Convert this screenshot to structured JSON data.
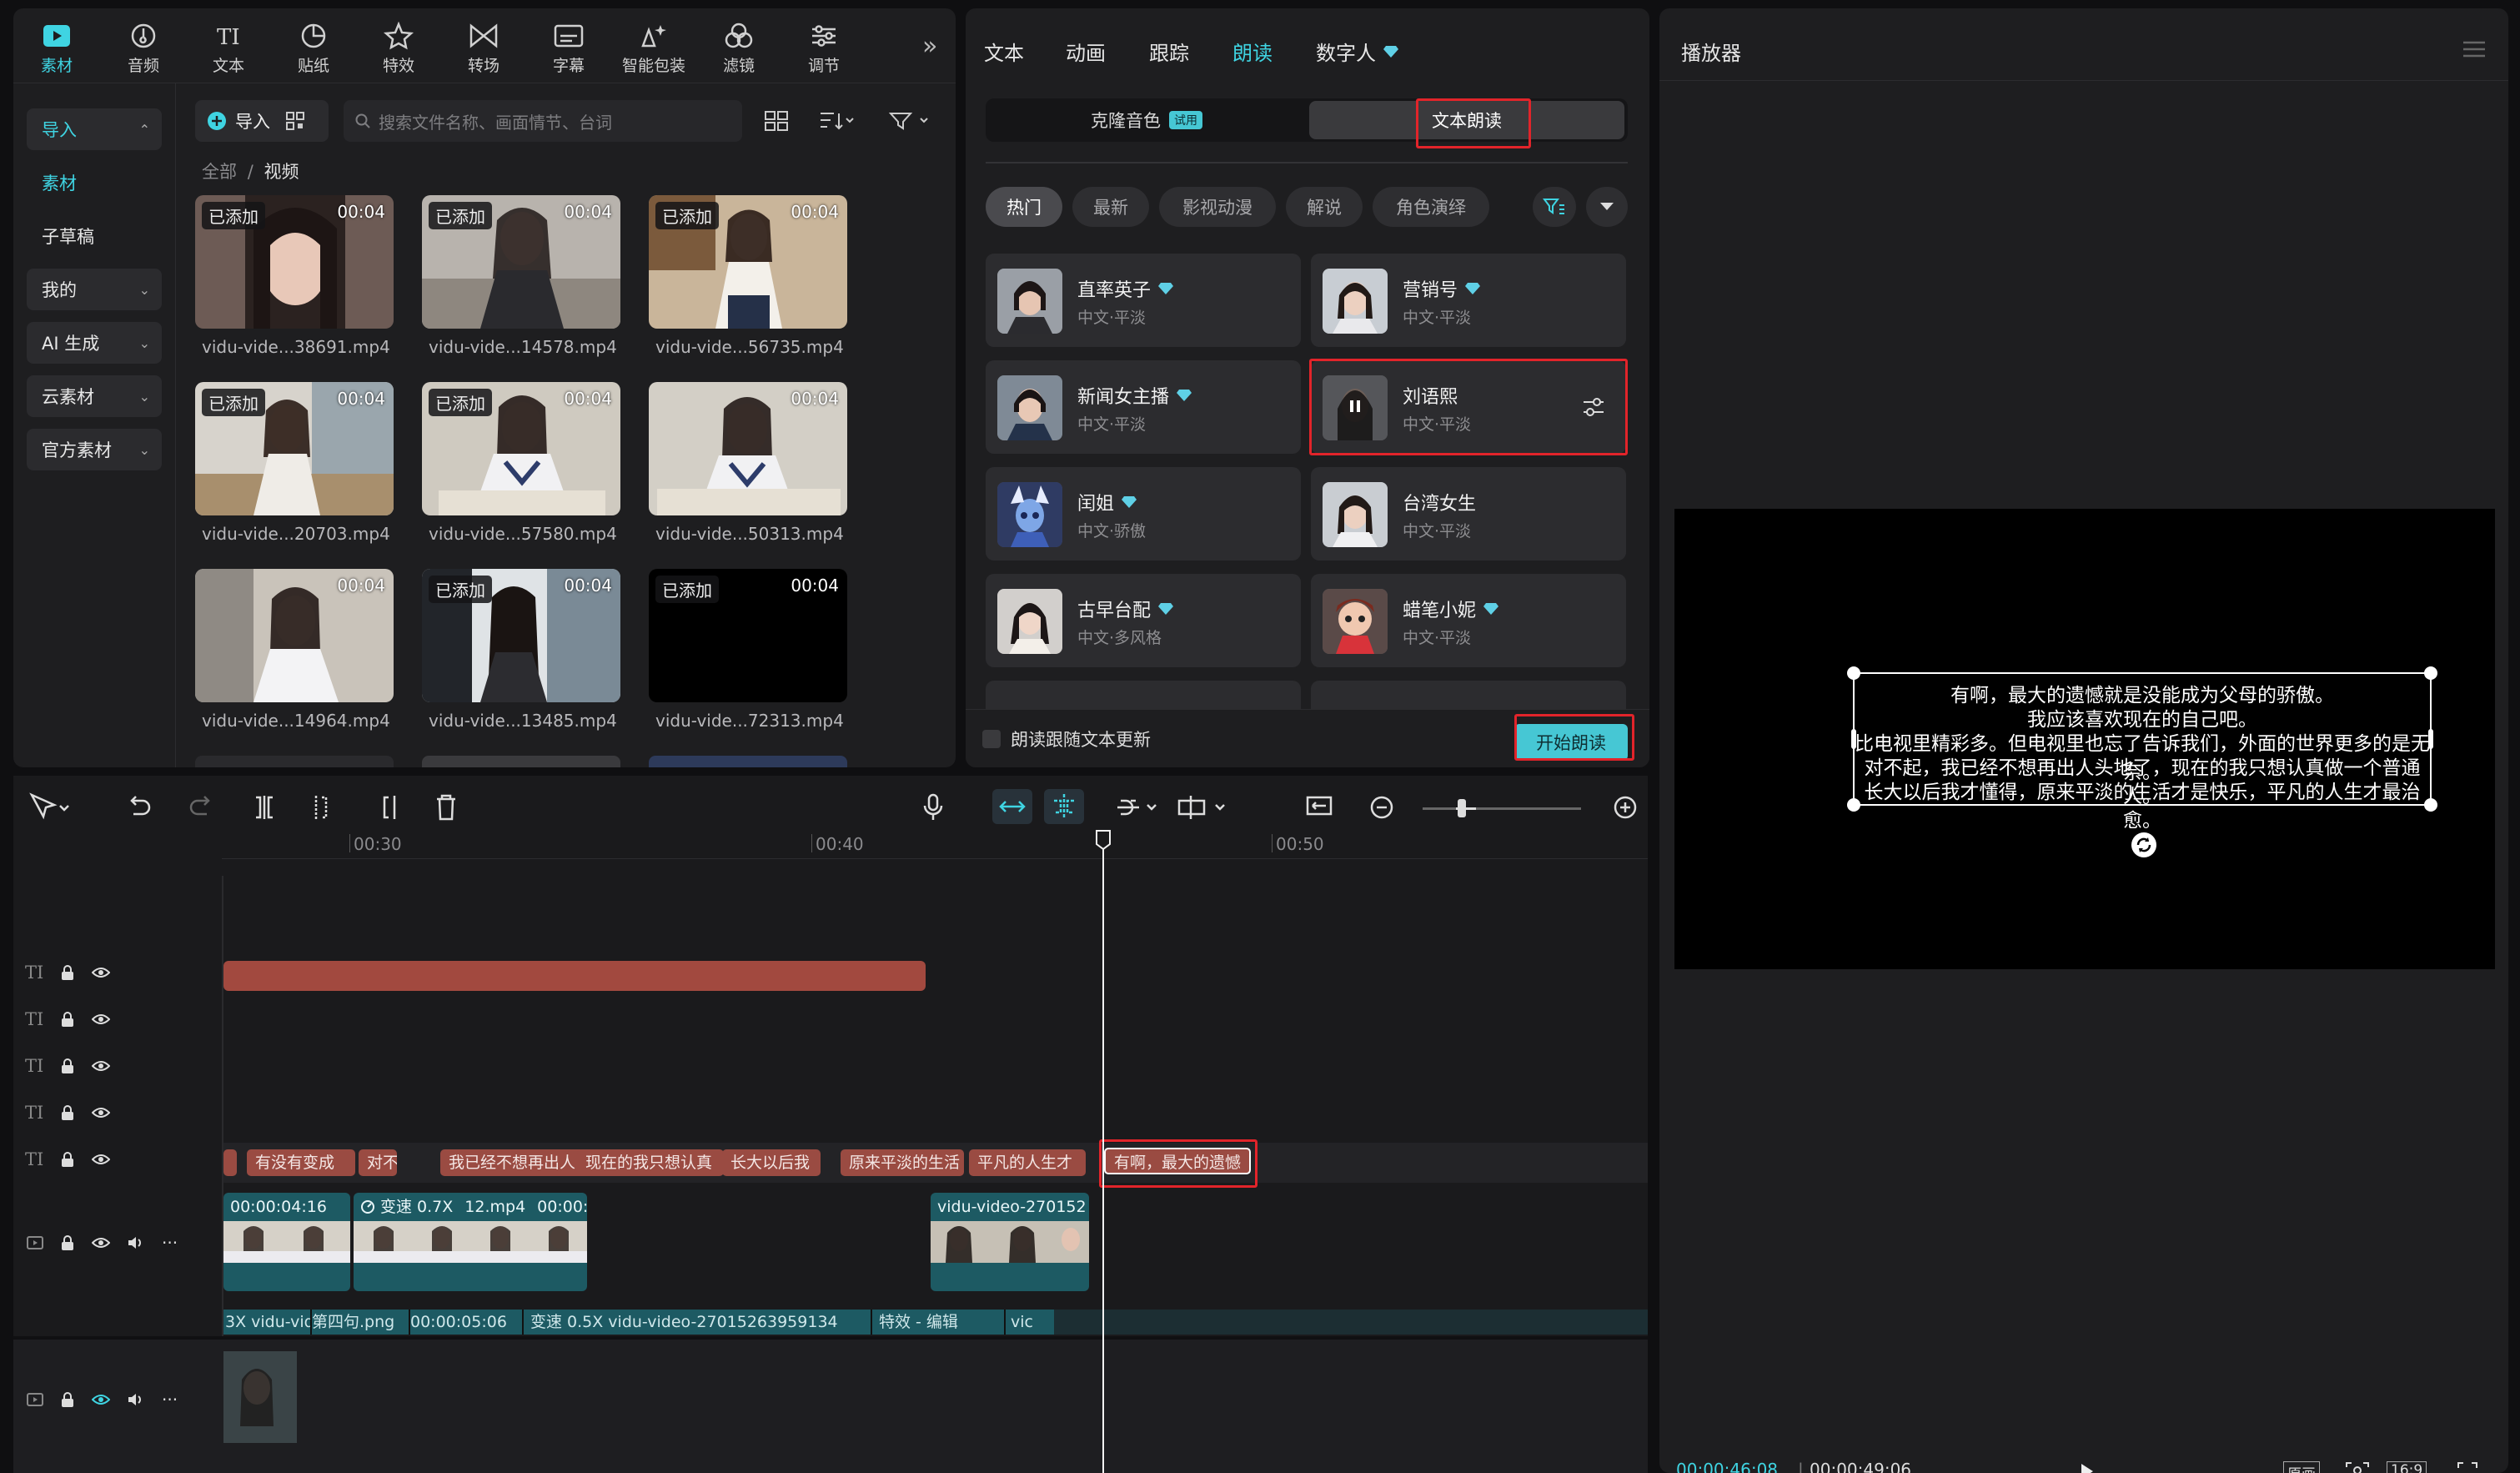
{
  "media": {
    "tools": [
      "素材",
      "音频",
      "文本",
      "贴纸",
      "特效",
      "转场",
      "字幕",
      "智能包装",
      "滤镜",
      "调节"
    ],
    "more_label": "»",
    "sidebar": [
      {
        "label": "导入"
      },
      {
        "label": "素材"
      },
      {
        "label": "子草稿"
      },
      {
        "label": "我的"
      },
      {
        "label": "AI 生成"
      },
      {
        "label": "云素材"
      },
      {
        "label": "官方素材"
      }
    ],
    "import_label": "导入",
    "search_placeholder": "搜索文件名称、画面情节、台词",
    "crumb_all": "全部",
    "crumb_sep": "/",
    "crumb_current": "视频",
    "files": [
      {
        "name": "vidu-vide...38691.mp4",
        "tag": "已添加",
        "dur": "00:04"
      },
      {
        "name": "vidu-vide...14578.mp4",
        "tag": "已添加",
        "dur": "00:04"
      },
      {
        "name": "vidu-vide...56735.mp4",
        "tag": "已添加",
        "dur": "00:04"
      },
      {
        "name": "vidu-vide...20703.mp4",
        "tag": "已添加",
        "dur": "00:04"
      },
      {
        "name": "vidu-vide...57580.mp4",
        "tag": "已添加",
        "dur": "00:04"
      },
      {
        "name": "vidu-vide...50313.mp4",
        "tag": "",
        "dur": "00:04"
      },
      {
        "name": "vidu-vide...14964.mp4",
        "tag": "",
        "dur": "00:04"
      },
      {
        "name": "vidu-vide...13485.mp4",
        "tag": "已添加",
        "dur": "00:04"
      },
      {
        "name": "vidu-vide...72313.mp4",
        "tag": "已添加",
        "dur": "00:04"
      }
    ]
  },
  "voice": {
    "tabs": [
      "文本",
      "动画",
      "跟踪",
      "朗读",
      "数字人"
    ],
    "clone_label": "克隆音色",
    "trial_label": "试用",
    "tts_label": "文本朗读",
    "filters": [
      "热门",
      "最新",
      "影视动漫",
      "解说",
      "角色演绎"
    ],
    "voices": [
      {
        "name": "直率英子",
        "desc": "中文·平淡"
      },
      {
        "name": "营销号",
        "desc": "中文·平淡"
      },
      {
        "name": "新闻女主播",
        "desc": "中文·平淡"
      },
      {
        "name": "刘语熙",
        "desc": "中文·平淡"
      },
      {
        "name": "闰姐",
        "desc": "中文·骄傲"
      },
      {
        "name": "台湾女生",
        "desc": "中文·平淡"
      },
      {
        "name": "古早台配",
        "desc": "中文·多风格"
      },
      {
        "name": "蜡笔小妮",
        "desc": "中文·平淡"
      }
    ],
    "follow_label": "朗读跟随文本更新",
    "start_label": "开始朗读"
  },
  "player": {
    "title": "播放器",
    "subtitles": [
      "有啊，最大的遗憾就是没能成为父母的骄傲。",
      "我应该喜欢现在的自己吧。",
      "比电视里精彩多。但电视里也忘了告诉我们，外面的世界更多的是无奈。",
      "对不起，我已经不想再出人头地了，现在的我只想认真做一个普通人。",
      "长大以后我才懂得，原来平淡的生活才是快乐，平凡的人生才最治愈。"
    ],
    "current_time": "00:00:46:08",
    "total_time": "00:00:49:06",
    "ratio_label": "16:9",
    "original_label": "原画"
  },
  "timeline": {
    "ruler": [
      "00:30",
      "00:40",
      "00:50"
    ],
    "text_clips": [
      {
        "label": "有没有变成"
      },
      {
        "label": "对不"
      },
      {
        "label": "我已经不想再出人"
      },
      {
        "label": "现在的我只想认真"
      },
      {
        "label": "长大以后我"
      },
      {
        "label": "原来平淡的生活"
      },
      {
        "label": "平凡的人生才"
      },
      {
        "label": "有啊，最大的遗憾"
      }
    ],
    "video_clips": [
      {
        "label": "00:00:04:16"
      },
      {
        "label": "变速 0.7X"
      },
      {
        "label": "12.mp4"
      },
      {
        "label": "00:00:"
      },
      {
        "label": "vidu-video-270152"
      }
    ],
    "lower_clips": [
      {
        "label": "3X  vidu-video"
      },
      {
        "label": "第四句.png"
      },
      {
        "label": "00:00:05:06"
      },
      {
        "label": "变速 0.5X  vidu-video-27015263959134"
      },
      {
        "label": "特效 - 编辑"
      },
      {
        "label": "vic"
      }
    ],
    "track_icon_text": "TI"
  },
  "colors": {
    "accent": "#3fd4e2",
    "highlight": "#e2242a",
    "text_clip": "#9a4b42",
    "video_clip": "#1d5a63"
  }
}
